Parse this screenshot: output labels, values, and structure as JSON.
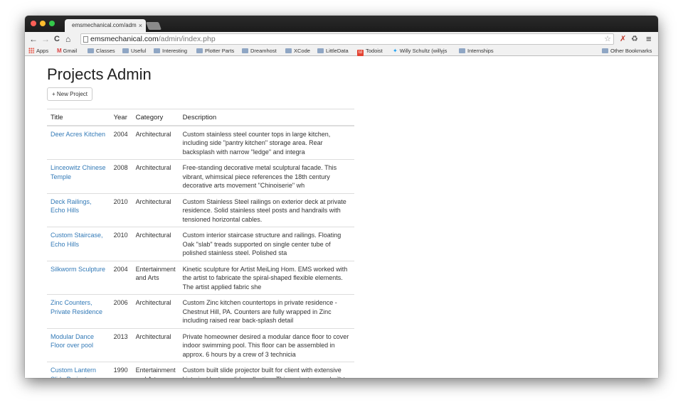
{
  "browser": {
    "tab_title": "emsmechanical.com/adm",
    "tab_close": "×",
    "url_host": "emsmechanical.com",
    "url_path": "/admin/index.php",
    "nav": {
      "back": "←",
      "forward": "→",
      "reload": "C",
      "home": "⌂"
    },
    "star": "☆",
    "menu": "≡"
  },
  "bookmarks": [
    {
      "label": "Apps",
      "icon": "apps-icon"
    },
    {
      "label": "Gmail",
      "icon": "gmail-icon"
    },
    {
      "label": "Classes",
      "icon": "folder-icon"
    },
    {
      "label": "Useful",
      "icon": "folder-icon"
    },
    {
      "label": "Interesting",
      "icon": "folder-icon"
    },
    {
      "label": "Plotter Parts",
      "icon": "folder-icon"
    },
    {
      "label": "Dreamhost",
      "icon": "folder-icon"
    },
    {
      "label": "XCode",
      "icon": "folder-icon"
    },
    {
      "label": "LittleData",
      "icon": "folder-icon"
    },
    {
      "label": "Todoist",
      "icon": "todoist-icon"
    },
    {
      "label": "Willy Schultz (willyjs",
      "icon": "twitter-icon"
    },
    {
      "label": "Internships",
      "icon": "folder-icon"
    }
  ],
  "other_bookmarks": "Other Bookmarks",
  "page": {
    "title": "Projects Admin",
    "new_project_button": "+ New Project",
    "columns": [
      "Title",
      "Year",
      "Category",
      "Description"
    ],
    "rows": [
      {
        "title": "Deer Acres Kitchen",
        "year": "2004",
        "category": "Architectural",
        "description": "Custom stainless steel counter tops in large kitchen, including side \"pantry kitchen\" storage area. Rear backsplash with narrow \"ledge\" and integra"
      },
      {
        "title": "Linceowitz Chinese Temple",
        "year": "2008",
        "category": "Architectural",
        "description": "Free-standing decorative metal sculptural facade. This vibrant, whimsical piece references the 18th century decorative arts movement \"Chinoiserie\" wh"
      },
      {
        "title": "Deck Railings, Echo Hills",
        "year": "2010",
        "category": "Architectural",
        "description": "Custom Stainless Steel railings on exterior deck at private residence. Solid stainless steel posts and handrails with tensioned horizontal cables."
      },
      {
        "title": "Custom Staircase, Echo Hills",
        "year": "2010",
        "category": "Architectural",
        "description": "Custom interior staircase structure and railings. Floating Oak \"slab\" treads supported on single center tube of polished stainless steel. Polished sta"
      },
      {
        "title": "Silkworm Sculpture",
        "year": "2004",
        "category": "Entertainment and Arts",
        "description": "Kinetic sculpture for Artist MeiLing Hom. EMS worked with the artist to fabricate the spiral-shaped flexible elements. The artist applied fabric she"
      },
      {
        "title": "Zinc Counters, Private Residence",
        "year": "2006",
        "category": "Architectural",
        "description": "Custom Zinc kitchen countertops in private residence - Chestnut Hill, PA. Counters are fully wrapped in Zinc including raised rear back-splash detail"
      },
      {
        "title": "Modular Dance Floor over pool",
        "year": "2013",
        "category": "Architectural",
        "description": "Private homeowner desired a modular dance floor to cover indoor swimming pool. This floor can be assembled in approx. 6 hours by a crew of 3 technicia"
      },
      {
        "title": "Custom Lantern Slide Projector",
        "year": "1990",
        "category": "Entertainment and Arts",
        "description": "Custom built slide projector built for client with extensive historical lantern slide collection. This projector was built to accommodate the slides"
      }
    ]
  }
}
